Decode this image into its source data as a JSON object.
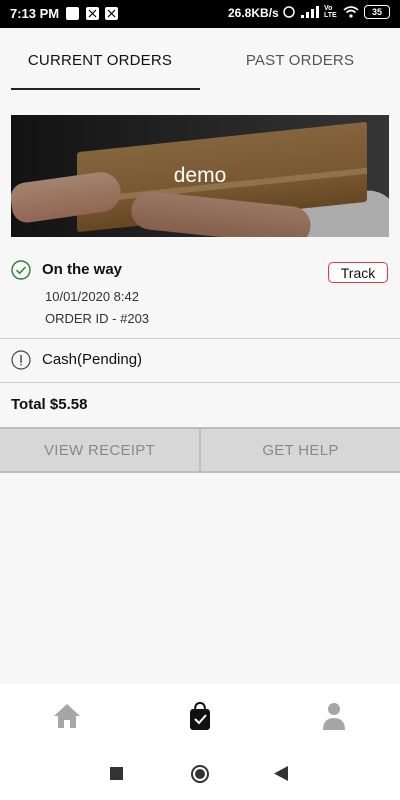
{
  "status_bar": {
    "time": "7:13 PM",
    "speed": "26.8KB/s",
    "battery": "35",
    "volte": "Vo LTE"
  },
  "tabs": [
    {
      "label": "CURRENT ORDERS",
      "active": true
    },
    {
      "label": "PAST ORDERS",
      "active": false
    }
  ],
  "banner": {
    "text": "demo"
  },
  "order": {
    "status": "On the way",
    "date": "10/01/2020 8:42",
    "order_id": "ORDER ID - #203",
    "track_label": "Track"
  },
  "payment": {
    "text": "Cash(Pending)"
  },
  "total": {
    "text": "Total $5.58"
  },
  "actions": {
    "view_receipt": "VIEW RECEIPT",
    "get_help": "GET HELP"
  },
  "bottom_nav": [
    {
      "icon": "home-icon",
      "active": false
    },
    {
      "icon": "shopping-bag-icon",
      "active": true
    },
    {
      "icon": "user-icon",
      "active": false
    }
  ],
  "colors": {
    "accent_red": "#e53935",
    "check_green": "#2e7d32",
    "button_gray": "#d7d7d7"
  }
}
